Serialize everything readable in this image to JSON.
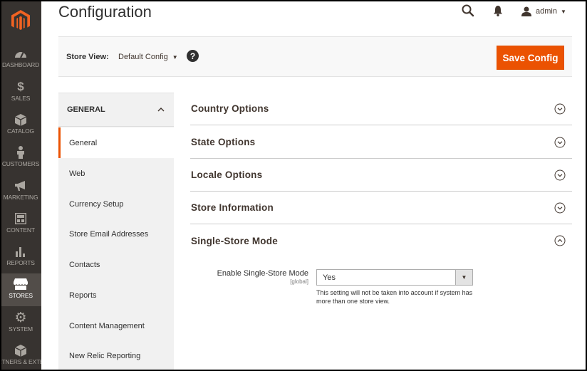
{
  "page": {
    "title": "Configuration"
  },
  "header": {
    "username": "admin"
  },
  "sidebar": {
    "items": [
      {
        "label": "DASHBOARD",
        "icon": "dashboard-icon"
      },
      {
        "label": "SALES",
        "icon": "dollar-icon"
      },
      {
        "label": "CATALOG",
        "icon": "cube-icon"
      },
      {
        "label": "CUSTOMERS",
        "icon": "person-icon"
      },
      {
        "label": "MARKETING",
        "icon": "megaphone-icon"
      },
      {
        "label": "CONTENT",
        "icon": "content-icon"
      },
      {
        "label": "REPORTS",
        "icon": "bar-chart-icon"
      },
      {
        "label": "STORES",
        "icon": "store-icon",
        "active": true
      },
      {
        "label": "SYSTEM",
        "icon": "gear-icon"
      },
      {
        "label": "FIND PARTNERS & EXTENSIONS",
        "icon": "partners-icon"
      }
    ]
  },
  "store_view": {
    "label": "Store View:",
    "value": "Default Config",
    "help": "?",
    "save_label": "Save Config"
  },
  "config_nav": {
    "tab_title": "GENERAL",
    "items": [
      "General",
      "Web",
      "Currency Setup",
      "Store Email Addresses",
      "Contacts",
      "Reports",
      "Content Management",
      "New Relic Reporting"
    ],
    "active": "General"
  },
  "sections": [
    {
      "title": "Country Options",
      "expanded": false
    },
    {
      "title": "State Options",
      "expanded": false
    },
    {
      "title": "Locale Options",
      "expanded": false
    },
    {
      "title": "Store Information",
      "expanded": false
    },
    {
      "title": "Single-Store Mode",
      "expanded": true
    }
  ],
  "single_store_field": {
    "label": "Enable Single-Store Mode",
    "scope": "[global]",
    "value": "Yes",
    "note": "This setting will not be taken into account if system has more than one store view."
  },
  "colors": {
    "sidebar_bg": "#373330",
    "sidebar_active": "#524d49",
    "accent": "#eb5202",
    "logo": "#f26322"
  }
}
